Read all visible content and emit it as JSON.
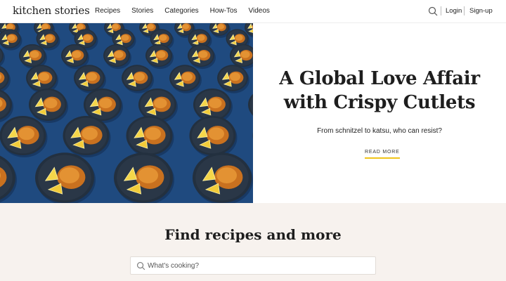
{
  "header": {
    "logo": "kitchen stories",
    "nav": [
      "Recipes",
      "Stories",
      "Categories",
      "How-Tos",
      "Videos"
    ],
    "search_icon": "search-icon",
    "login_label": "Login",
    "signup_label": "Sign-up"
  },
  "hero": {
    "title_line1": "A Global Love Affair",
    "title_line2": "with Crispy Cutlets",
    "subtitle": "From schnitzel to katsu, who can resist?",
    "cta_label": "READ MORE",
    "image_subject": "plates of crispy cutlets with lemon wedges on blue background",
    "accent_color": "#f0c419",
    "image_bg_color": "#1f4a7f"
  },
  "find": {
    "title": "Find recipes and more",
    "search_placeholder": "What's cooking?",
    "search_value": "",
    "bg_color": "#f7f2ee"
  }
}
